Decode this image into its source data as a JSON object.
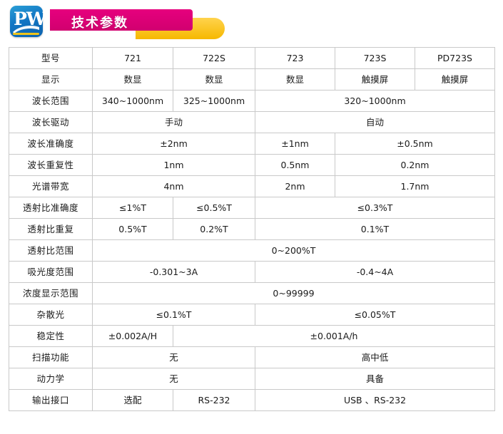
{
  "header": {
    "logo_text": "PW",
    "logo_name": "pw-logo",
    "title": "技术参数"
  },
  "colors": {
    "logo_blue": "#1176c4",
    "ribbon_pink": "#e6007e",
    "ribbon_yellow": "#f6b800",
    "border": "#c9c9c9"
  },
  "table": {
    "rows": [
      {
        "label": "型号",
        "cells": [
          {
            "t": "721",
            "span": 1
          },
          {
            "t": "722S",
            "span": 1
          },
          {
            "t": "723",
            "span": 1
          },
          {
            "t": "723S",
            "span": 1
          },
          {
            "t": "PD723S",
            "span": 1
          }
        ]
      },
      {
        "label": "显示",
        "cells": [
          {
            "t": "数显",
            "span": 1
          },
          {
            "t": "数显",
            "span": 1
          },
          {
            "t": "数显",
            "span": 1
          },
          {
            "t": "触摸屏",
            "span": 1
          },
          {
            "t": "触摸屏",
            "span": 1
          }
        ]
      },
      {
        "label": "波长范围",
        "cells": [
          {
            "t": "340~1000nm",
            "span": 1
          },
          {
            "t": "325~1000nm",
            "span": 1
          },
          {
            "t": "320~1000nm",
            "span": 3
          }
        ]
      },
      {
        "label": "波长驱动",
        "cells": [
          {
            "t": "手动",
            "span": 2
          },
          {
            "t": "自动",
            "span": 3
          }
        ]
      },
      {
        "label": "波长准确度",
        "cells": [
          {
            "t": "±2nm",
            "span": 2
          },
          {
            "t": "±1nm",
            "span": 1
          },
          {
            "t": "±0.5nm",
            "span": 2
          }
        ]
      },
      {
        "label": "波长重复性",
        "cells": [
          {
            "t": "1nm",
            "span": 2
          },
          {
            "t": "0.5nm",
            "span": 1
          },
          {
            "t": "0.2nm",
            "span": 2
          }
        ]
      },
      {
        "label": "光谱带宽",
        "cells": [
          {
            "t": "4nm",
            "span": 2
          },
          {
            "t": "2nm",
            "span": 1
          },
          {
            "t": "1.7nm",
            "span": 2
          }
        ]
      },
      {
        "label": "透射比准确度",
        "cells": [
          {
            "t": "≤1%T",
            "span": 1
          },
          {
            "t": "≤0.5%T",
            "span": 1
          },
          {
            "t": "≤0.3%T",
            "span": 3
          }
        ]
      },
      {
        "label": "透射比重复",
        "cells": [
          {
            "t": "0.5%T",
            "span": 1
          },
          {
            "t": "0.2%T",
            "span": 1
          },
          {
            "t": "0.1%T",
            "span": 3
          }
        ]
      },
      {
        "label": "透射比范围",
        "cells": [
          {
            "t": "0~200%T",
            "span": 5
          }
        ]
      },
      {
        "label": "吸光度范围",
        "cells": [
          {
            "t": "-0.301~3A",
            "span": 2
          },
          {
            "t": "-0.4~4A",
            "span": 3
          }
        ]
      },
      {
        "label": "浓度显示范围",
        "cells": [
          {
            "t": "0~99999",
            "span": 5
          }
        ]
      },
      {
        "label": "杂散光",
        "cells": [
          {
            "t": "≤0.1%T",
            "span": 2
          },
          {
            "t": "≤0.05%T",
            "span": 3
          }
        ]
      },
      {
        "label": "稳定性",
        "cells": [
          {
            "t": "±0.002A/H",
            "span": 1
          },
          {
            "t": "±0.001A/h",
            "span": 4
          }
        ]
      },
      {
        "label": "扫描功能",
        "cells": [
          {
            "t": "无",
            "span": 2
          },
          {
            "t": "高中低",
            "span": 3
          }
        ]
      },
      {
        "label": "动力学",
        "cells": [
          {
            "t": "无",
            "span": 2
          },
          {
            "t": "具备",
            "span": 3
          }
        ]
      },
      {
        "label": "输出接口",
        "cells": [
          {
            "t": "选配",
            "span": 1
          },
          {
            "t": "RS-232",
            "span": 1
          },
          {
            "t": "USB 、RS-232",
            "span": 3
          }
        ]
      }
    ]
  }
}
